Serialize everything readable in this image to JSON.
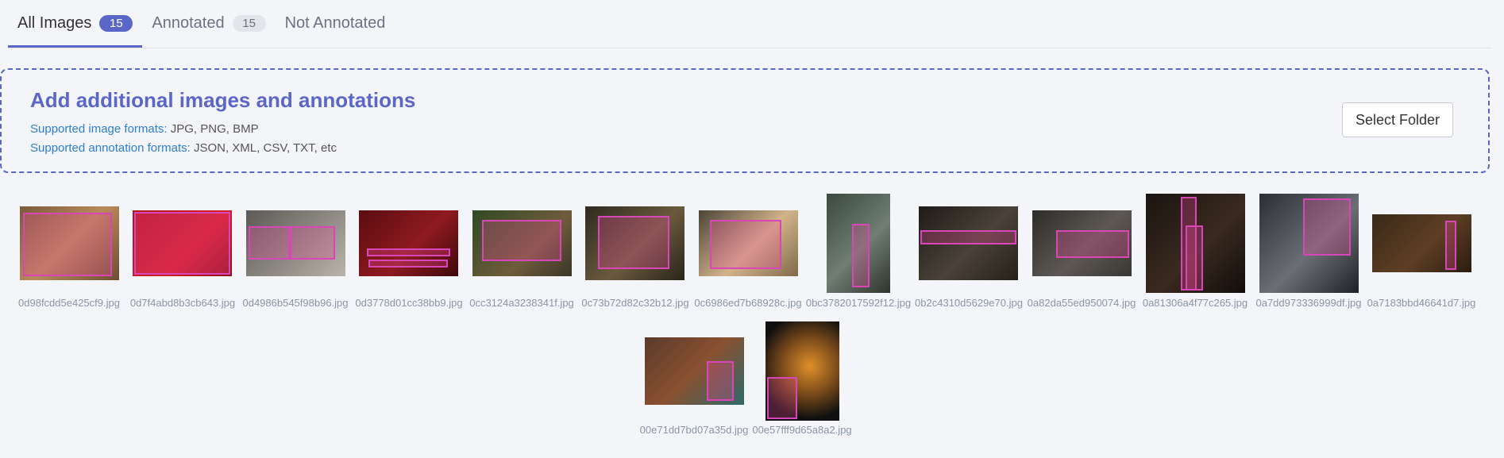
{
  "tabs": [
    {
      "label": "All Images",
      "count": "15",
      "active": true
    },
    {
      "label": "Annotated",
      "count": "15",
      "active": false
    },
    {
      "label": "Not Annotated",
      "count": "",
      "active": false
    }
  ],
  "upload": {
    "title": "Add additional images and annotations",
    "image_formats_label": "Supported image formats:",
    "image_formats_value": " JPG, PNG, BMP",
    "annotation_formats_label": "Supported annotation formats:",
    "annotation_formats_value": " JSON, XML, CSV, TXT, etc",
    "select_button": "Select Folder"
  },
  "colors": {
    "accent": "#5a67c8",
    "bbox": "#d946b8"
  },
  "images": [
    {
      "filename": "0d98fcdd5e425cf9.jpg"
    },
    {
      "filename": "0d7f4abd8b3cb643.jpg"
    },
    {
      "filename": "0d4986b545f98b96.jpg"
    },
    {
      "filename": "0d3778d01cc38bb9.jpg"
    },
    {
      "filename": "0cc3124a3238341f.jpg"
    },
    {
      "filename": "0c73b72d82c32b12.jpg"
    },
    {
      "filename": "0c6986ed7b68928c.jpg"
    },
    {
      "filename": "0bc3782017592f12.jpg"
    },
    {
      "filename": "0b2c4310d5629e70.jpg"
    },
    {
      "filename": "0a82da55ed950074.jpg"
    },
    {
      "filename": "0a81306a4f77c265.jpg"
    },
    {
      "filename": "0a7dd973336999df.jpg"
    },
    {
      "filename": "0a7183bbd46641d7.jpg"
    },
    {
      "filename": "00e71dd7bd07a35d.jpg"
    },
    {
      "filename": "00e57fff9d65a8a2.jpg"
    }
  ]
}
